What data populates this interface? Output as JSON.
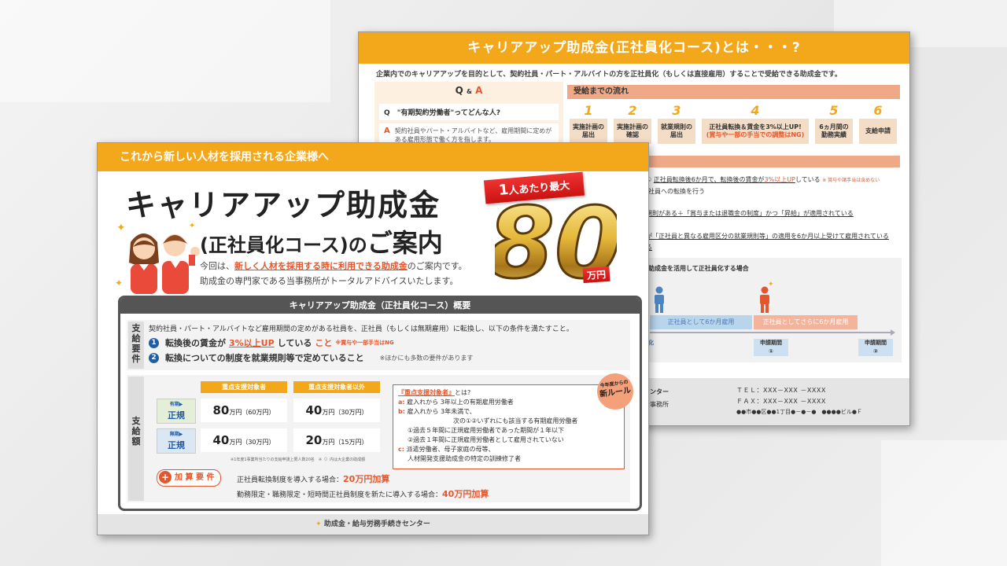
{
  "back_doc": {
    "title": "キャリアアップ助成金(正社員化コース)とは・・・?",
    "intro": "企業内でのキャリアアップを目的として、契約社員・パート・アルバイトの方を正社員化（もしくは直接雇用）することで受給できる助成金です。",
    "qa": {
      "q_letter": "Q",
      "amp": "&",
      "a_letter": "A",
      "question_mark": "Q",
      "question": "\"有期契約労働者\"ってどんな人?",
      "answer_mark": "A",
      "answer": "契約社員やパート・アルバイトなど、雇用期間に定めがある雇用形態で働く方を指します。"
    },
    "flow": {
      "heading": "受給までの流れ",
      "steps": [
        {
          "num": "1",
          "label": "実施計画の届出"
        },
        {
          "num": "2",
          "label": "実施計画の確認"
        },
        {
          "num": "3",
          "label": "就業規則の届出"
        },
        {
          "num": "4",
          "label": "正社員転換＆賃金を3%以上UP!",
          "label_red": "(賞与や一部の手当での調整はNG)"
        },
        {
          "num": "5",
          "label": "6ヵ月間の勤務実績"
        },
        {
          "num": "6",
          "label": "支給申請"
        }
      ]
    },
    "conditions": {
      "c1_a": "① ",
      "c1_b": "正社員転換後6か月で、転換後の賃金が",
      "c1_red": "3%以上UP",
      "c1_c": "している",
      "c1_note": "※ 賞与や諸手当は含めない",
      "c2": "社員への転換を行う",
      "c3": "規則がある＋「賞与または退職金の制度」かつ「昇給」が適用されている",
      "c4": "が「正社員と異なる雇用区分の就業規則等」の適用を6か月以上受けて雇用されている",
      "c5": "る"
    },
    "timeline": {
      "title": "助成金を活用して正社員化する場合",
      "bar1": "正社員として6か月雇用",
      "bar2": "正社員としてさらに6か月雇用",
      "left_label": "化",
      "app1_l1": "申請期間",
      "app1_l2": "①",
      "app2_l1": "申請期間",
      "app2_l2": "②"
    },
    "footer": {
      "name": "センター",
      "office": "士事務所",
      "tel": "ＴＥＬ：XXX－XXX －XXXX",
      "fax": "ＦＡＸ：XXX－XXX －XXXX",
      "address": "●●市●●区●●1丁目●－●－●　●●●●ビル●Ｆ"
    }
  },
  "front_doc": {
    "top_banner": "これから新しい人材を採用される企業様へ",
    "title_line1": "キャリアアップ助成金",
    "title_line2_a": "(正社員化コース)の",
    "title_line2_b": "ご案内",
    "ribbon_one": "1",
    "ribbon_rest": "人あたり最大",
    "big_amount": "80",
    "unit": "万円",
    "desc1_a": "今回は、",
    "desc1_em": "新しく人材を採用する時に利用できる助成金",
    "desc1_b": "のご案内です。",
    "desc2": "助成金の専門家である当事務所がトータルアドバイスいたします。",
    "panel": {
      "header": "キャリアアップ助成金（正社員化コース）概要",
      "req_label": "支給要件",
      "req_intro": "契約社員・パート・アルバイトなど雇用期間の定めがある社員を、正社員（もしくは無期雇用）に転換し、以下の条件を満たすこと。",
      "req1_num": "1",
      "req1_a": "転換後の賃金が",
      "req1_red": "3%以上UP",
      "req1_b": "している",
      "req1_red2": "こと",
      "req1_note": "※賞与や一部手当はNG",
      "req2_num": "2",
      "req2_text": "転換についての制度を就業規則等で定めていること",
      "req2_note": "※ほかにも多数の要件があります",
      "amt_label": "支給額",
      "col1": "重点支援対象者",
      "col2": "重点支援対象者以外",
      "row1_small": "有期▶",
      "row1": "正規",
      "row2_small": "無期▶",
      "row2": "正規",
      "r1c1": "80",
      "r1c1_u": "万円（60万円）",
      "r1c2": "40",
      "r1c2_u": "万円（30万円）",
      "r2c1": "40",
      "r2c1_u": "万円（30万円）",
      "r2c2": "20",
      "r2c2_u": "万円（15万円）",
      "amt_note": "※1年度1事業所当たりの支給申請上限人数20名　※（）内は大企業の助成額",
      "def_title": "『重点支援対象者』",
      "def_q": "とは?",
      "def_a_label": "a:",
      "def_a": "雇入れから 3年以上の有期雇用労働者",
      "def_b_label": "b:",
      "def_b": "雇入れから 3年未満で、",
      "def_b2": "次の①②いずれにも該当する有期雇用労働者",
      "def_b3": "①過去５年間に正規雇用労働者であった期間が１年以下",
      "def_b4": "②過去１年間に正規雇用労働者として雇用されていない",
      "def_c_label": "c:",
      "def_c": "派遣労働者、母子家庭の母等、",
      "def_c2": "人材開発支援助成金の特定の訓練修了者",
      "newrule_l1": "今年度からの",
      "newrule_l2": "新ルール",
      "kasan_plus": "+",
      "kasan": "加 算 要 件",
      "ks1_a": "正社員転換制度を導入する場合：",
      "ks1_red": "20万円加算",
      "ks2_a": "勤務限定・職務限定・短時間正社員制度を新たに導入する場合：",
      "ks2_red": "40万円加算"
    },
    "footer": "助成金・給与労務手続きセンター"
  },
  "colors": {
    "accent_orange": "#f3a81b",
    "accent_red": "#e4572e",
    "accent_blue": "#1f5da8"
  }
}
